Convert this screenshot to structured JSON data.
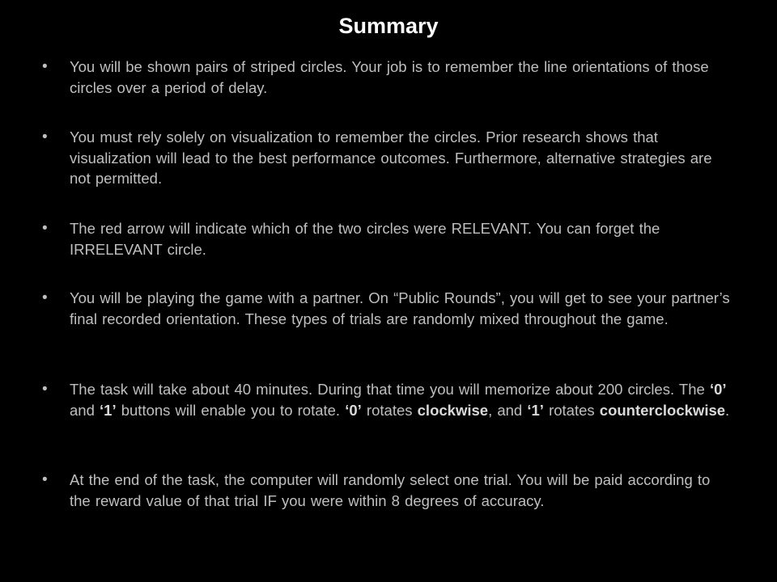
{
  "slide": {
    "title": "Summary",
    "bullet_symbol": "•",
    "bullets": [
      {
        "segments": [
          {
            "text": "You will be shown pairs of striped circles.  Your job is to remember the line orientations of those circles over a period of delay.",
            "bold": false
          }
        ]
      },
      {
        "segments": [
          {
            "text": "You must rely solely on visualization to remember the circles. Prior research shows that visualization will lead to the best performance outcomes. Furthermore, alternative strategies are not permitted.",
            "bold": false
          }
        ]
      },
      {
        "segments": [
          {
            "text": "The red arrow will indicate which of the two circles were RELEVANT. You can forget the IRRELEVANT circle.",
            "bold": false
          }
        ]
      },
      {
        "segments": [
          {
            "text": "You will be playing the game with a partner.  On “Public Rounds”, you will get to see your partner’s final recorded orientation.  These types of trials are randomly mixed throughout the game.",
            "bold": false
          }
        ]
      },
      {
        "segments": [
          {
            "text": "The task will take about 40 minutes.  During that time you will memorize about 200 circles. The ",
            "bold": false
          },
          {
            "text": "‘0’",
            "bold": true
          },
          {
            "text": " and ",
            "bold": false
          },
          {
            "text": "‘1’",
            "bold": true
          },
          {
            "text": " buttons will enable you to rotate. ",
            "bold": false
          },
          {
            "text": "‘0’",
            "bold": true
          },
          {
            "text": " rotates ",
            "bold": false
          },
          {
            "text": "clockwise",
            "bold": true
          },
          {
            "text": ", and ",
            "bold": false
          },
          {
            "text": "‘1’",
            "bold": true
          },
          {
            "text": " rotates ",
            "bold": false
          },
          {
            "text": "counterclockwise",
            "bold": true
          },
          {
            "text": ".",
            "bold": false
          }
        ]
      },
      {
        "segments": [
          {
            "text": "At the end of the task, the computer will randomly select one trial.  You will be paid according to the reward value of that trial IF you were within 8 degrees of accuracy.",
            "bold": false
          }
        ]
      }
    ]
  },
  "colors": {
    "background": "#000000",
    "title": "#ffffff",
    "body_text": "#bfbfbf"
  }
}
